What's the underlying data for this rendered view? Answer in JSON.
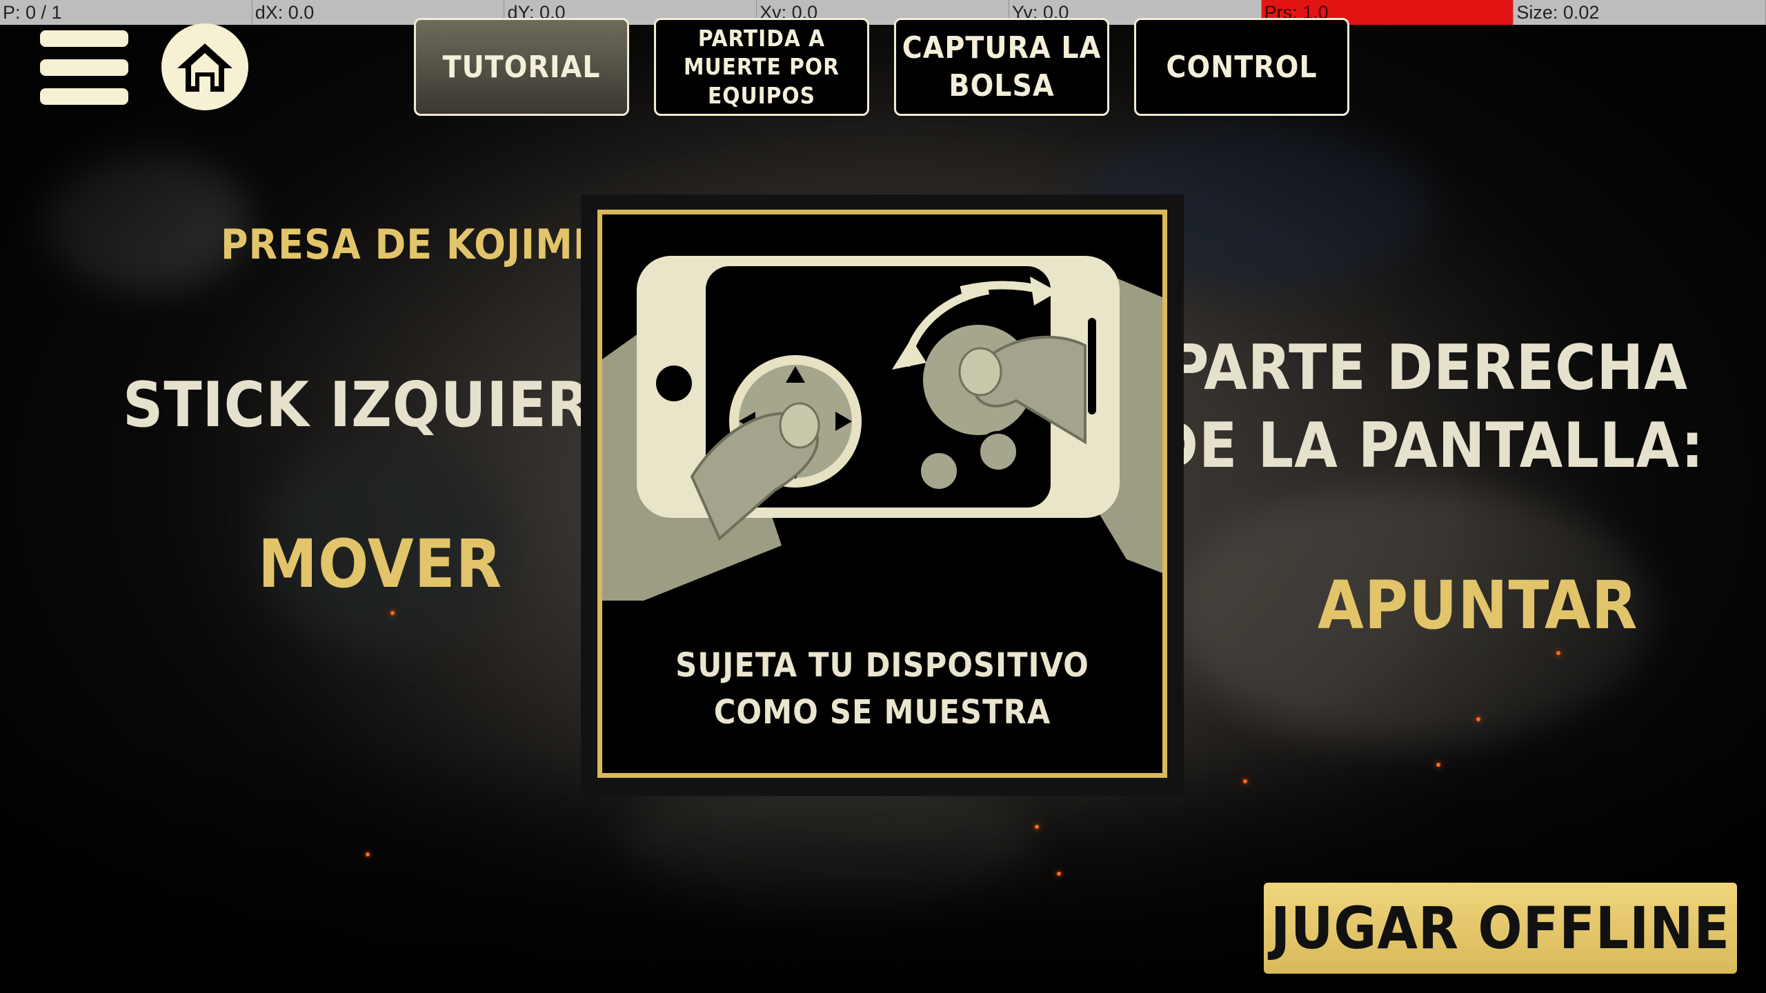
{
  "debug": {
    "pointer": "P: 0 / 1",
    "dx": "dX: 0.0",
    "dy": "dY: 0.0",
    "xv": "Xv: 0.0",
    "yv": "Yv: 0.0",
    "prs": "Prs: 1.0",
    "size": "Size: 0.02"
  },
  "tabs": [
    {
      "label": "TUTORIAL",
      "active": true
    },
    {
      "label": "PARTIDA A MUERTE POR EQUIPOS",
      "active": false
    },
    {
      "label": "CAPTURA LA BOLSA",
      "active": false
    },
    {
      "label": "CONTROL",
      "active": false
    }
  ],
  "map_name": "PRESA DE KOJIMBA",
  "left": {
    "control": "STICK IZQUIERDO:",
    "action": "MOVER"
  },
  "right": {
    "control": "PARTE DERECHA DE LA PANTALLA:",
    "action": "APUNTAR"
  },
  "card": {
    "caption": "SUJETA TU DISPOSITIVO COMO SE MUESTRA"
  },
  "play_button": "JUGAR OFFLINE",
  "icons": {
    "menu": "hamburger-menu-icon",
    "home": "home-icon"
  },
  "colors": {
    "accent_gold": "#e2c46a",
    "light_text": "#e6e1cd",
    "debug_highlight": "#e31414"
  }
}
